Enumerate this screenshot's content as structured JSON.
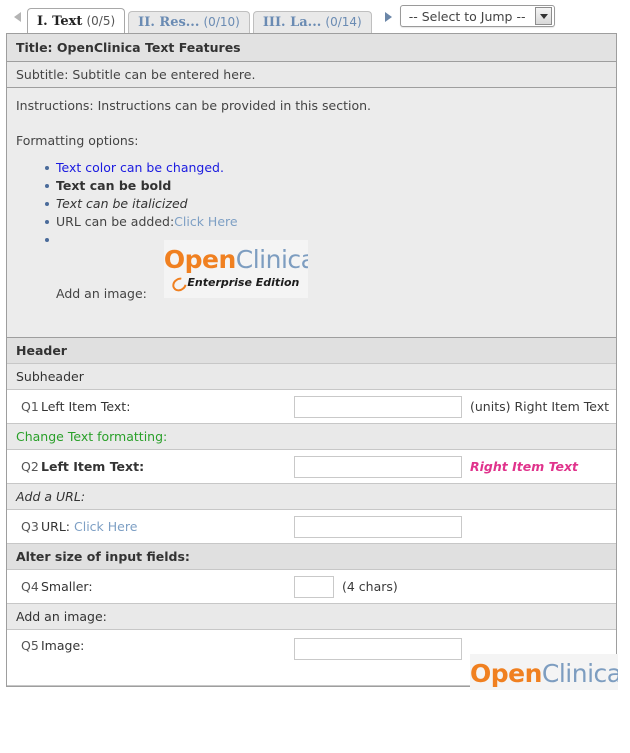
{
  "tabs": {
    "prev_arrow_icon": "chevron-left-icon",
    "next_arrow_icon": "chevron-right-icon",
    "items": [
      {
        "roman": "I. Text",
        "count": "(0/5)",
        "active": true
      },
      {
        "roman": "II. Res...",
        "count": "(0/10)",
        "active": false
      },
      {
        "roman": "III. La...",
        "count": "(0/14)",
        "active": false
      }
    ],
    "jump": {
      "selected": "-- Select to Jump --",
      "caret_icon": "chevron-down-icon"
    }
  },
  "section": {
    "title": "Title: OpenClinica Text Features",
    "subtitle": "Subtitle: Subtitle can be entered here.",
    "instructions": "Instructions: Instructions can be provided in this section.",
    "formatting_label": "Formatting options:",
    "formatting_items": {
      "color": "Text color can be changed.",
      "bold": "Text can be bold",
      "italic": "Text can be italicized",
      "url_prefix": "URL can be added:",
      "url_link": "Click Here",
      "image": "Add an image:"
    },
    "logo": {
      "open": "Open",
      "clinica": "Clinica",
      "edition": "Enterprise Edition"
    }
  },
  "groups": {
    "header": "Header",
    "subheader": "Subheader",
    "change_text_formatting": "Change Text formatting:",
    "add_a_url": "Add a URL:",
    "alter_size": "Alter size of input fields:",
    "add_an_image": "Add an image:"
  },
  "questions": [
    {
      "num": "Q1",
      "left": "Left Item Text:",
      "value": "",
      "right": "(units) Right Item Text"
    },
    {
      "num": "Q2",
      "left": "Left Item Text:",
      "value": "",
      "right": "Right Item Text"
    },
    {
      "num": "Q3",
      "left_prefix": "URL:",
      "left_link": "Click Here",
      "value": "",
      "right": ""
    },
    {
      "num": "Q4",
      "left": "Smaller:",
      "value": "",
      "right": "(4 chars)"
    },
    {
      "num": "Q5",
      "left": "Image:",
      "value": "",
      "right": ""
    }
  ],
  "colors": {
    "link": "#7d9fc4",
    "blue_text": "#1a1ae0",
    "green_header": "#2aa02a",
    "pink_text": "#e0338c",
    "logo_orange": "#f08020",
    "logo_blue": "#7d9dc0",
    "tab_inactive_text": "#6a8bb3"
  }
}
